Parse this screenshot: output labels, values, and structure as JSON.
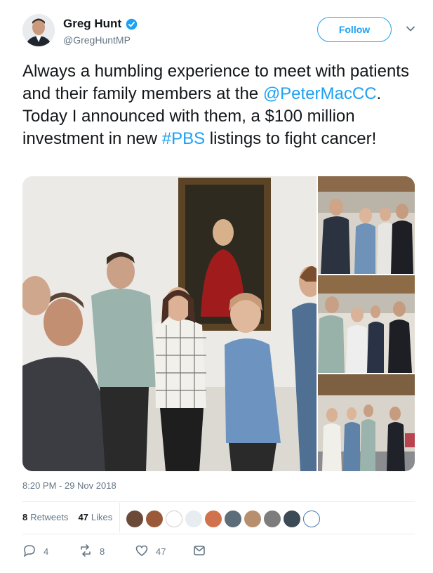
{
  "user": {
    "name": "Greg Hunt",
    "handle": "@GregHuntMP",
    "follow_label": "Follow"
  },
  "tweet": {
    "text_1": "Always a humbling experience to meet with patients and their family members at the ",
    "mention": "@PeterMacCC",
    "text_2": ". Today I announced with them, a $100 million investment in new ",
    "hashtag": "#PBS",
    "text_3": " listings to fight cancer!"
  },
  "timestamp": "8:20 PM - 29 Nov 2018",
  "stats": {
    "retweets_count": "8",
    "retweets_label": "Retweets",
    "likes_count": "47",
    "likes_label": "Likes"
  },
  "actions": {
    "reply_count": "4",
    "retweet_count": "8",
    "like_count": "47"
  },
  "icons": [
    "verified-icon",
    "caret-down-icon",
    "reply-icon",
    "retweet-icon",
    "like-icon",
    "message-icon"
  ],
  "colors": {
    "accent": "#1da1f2",
    "text": "#14171a",
    "muted": "#657786",
    "divider": "#e6ecf0"
  }
}
